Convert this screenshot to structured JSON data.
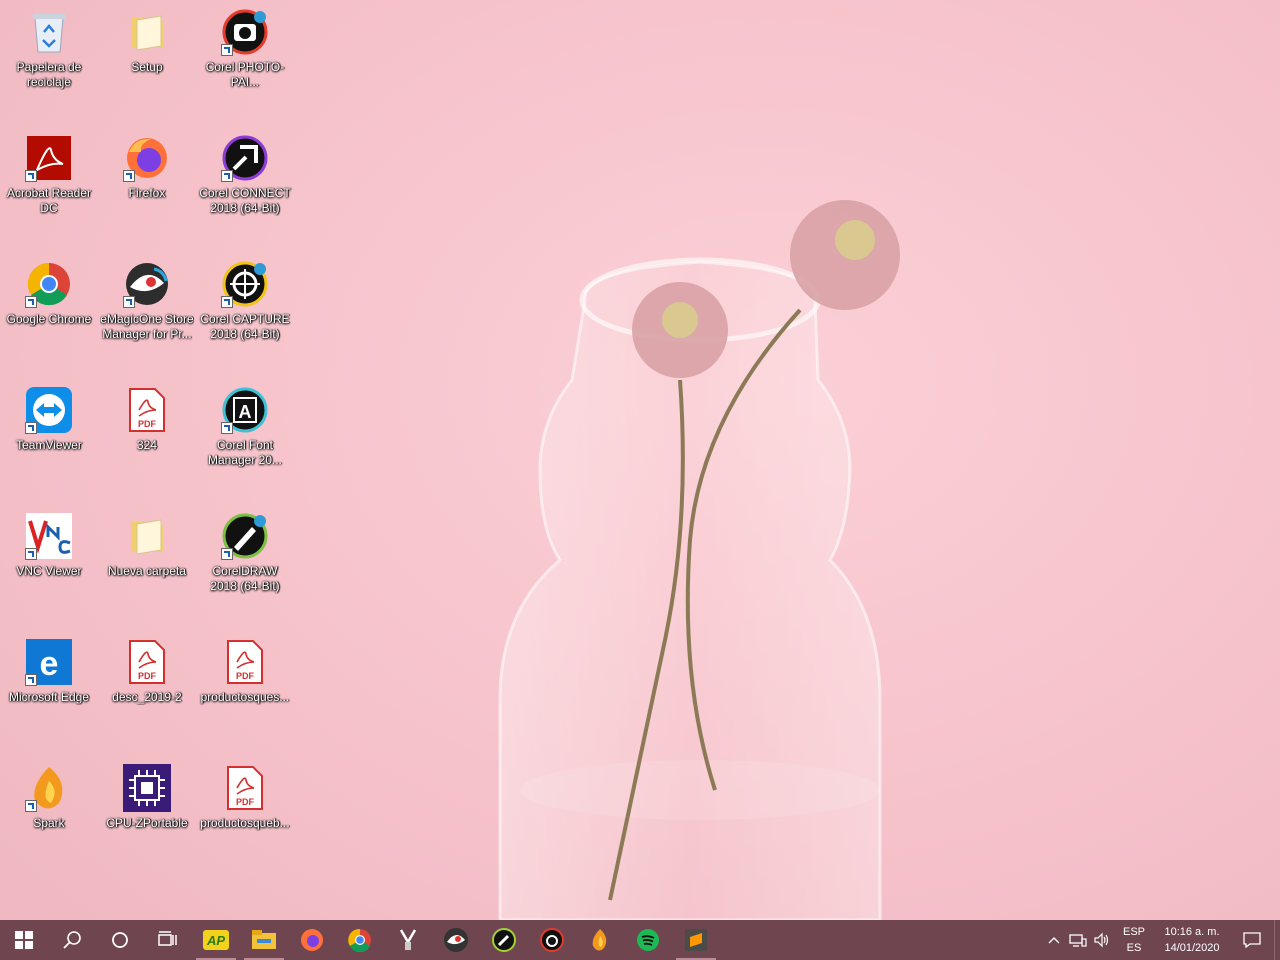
{
  "desktop": {
    "icons": [
      {
        "label": "Papelera de reciclaje",
        "icon": "recycle-bin-icon"
      },
      {
        "label": "Setup",
        "icon": "folder-icon"
      },
      {
        "label": "Corel PHOTO-PAI...",
        "icon": "corel-photo-paint-icon"
      },
      {
        "label": "Acrobat Reader DC",
        "icon": "acrobat-reader-icon"
      },
      {
        "label": "Firefox",
        "icon": "firefox-icon"
      },
      {
        "label": "Corel CONNECT 2018 (64-Bit)",
        "icon": "corel-connect-icon"
      },
      {
        "label": "Google Chrome",
        "icon": "chrome-icon"
      },
      {
        "label": "eMagicOne Store Manager for Pr...",
        "icon": "emagicone-icon"
      },
      {
        "label": "Corel CAPTURE 2018 (64-Bit)",
        "icon": "corel-capture-icon"
      },
      {
        "label": "TeamViewer",
        "icon": "teamviewer-icon"
      },
      {
        "label": "324",
        "icon": "pdf-file-icon"
      },
      {
        "label": "Corel Font Manager 20...",
        "icon": "corel-font-manager-icon"
      },
      {
        "label": "VNC Viewer",
        "icon": "vnc-viewer-icon"
      },
      {
        "label": "Nueva carpeta",
        "icon": "folder-icon"
      },
      {
        "label": "CorelDRAW 2018 (64-Bit)",
        "icon": "coreldraw-icon"
      },
      {
        "label": "Microsoft Edge",
        "icon": "edge-icon"
      },
      {
        "label": "desc_2019-2",
        "icon": "pdf-file-icon"
      },
      {
        "label": "productosques...",
        "icon": "pdf-file-icon"
      },
      {
        "label": "Spark",
        "icon": "spark-icon"
      },
      {
        "label": "CPU-ZPortable",
        "icon": "cpu-z-icon"
      },
      {
        "label": "productosqueb...",
        "icon": "pdf-file-icon"
      }
    ]
  },
  "taskbar": {
    "buttons": [
      "start-icon",
      "search-icon",
      "cortana-icon",
      "task-view-icon",
      "ap-app-icon",
      "file-explorer-icon",
      "firefox-icon",
      "chrome-icon",
      "app-tool-icon",
      "emagicone-icon",
      "corel-connect-icon",
      "corel-photo-paint-icon",
      "spark-icon",
      "spotify-icon",
      "sublime-text-icon"
    ],
    "tray": {
      "language_top": "ESP",
      "language_bottom": "ES",
      "time": "10:16 a. m.",
      "date": "14/01/2020"
    }
  },
  "colors": {
    "taskbar_bg": "#6f4550",
    "wallpaper": "#f6c2ca"
  }
}
